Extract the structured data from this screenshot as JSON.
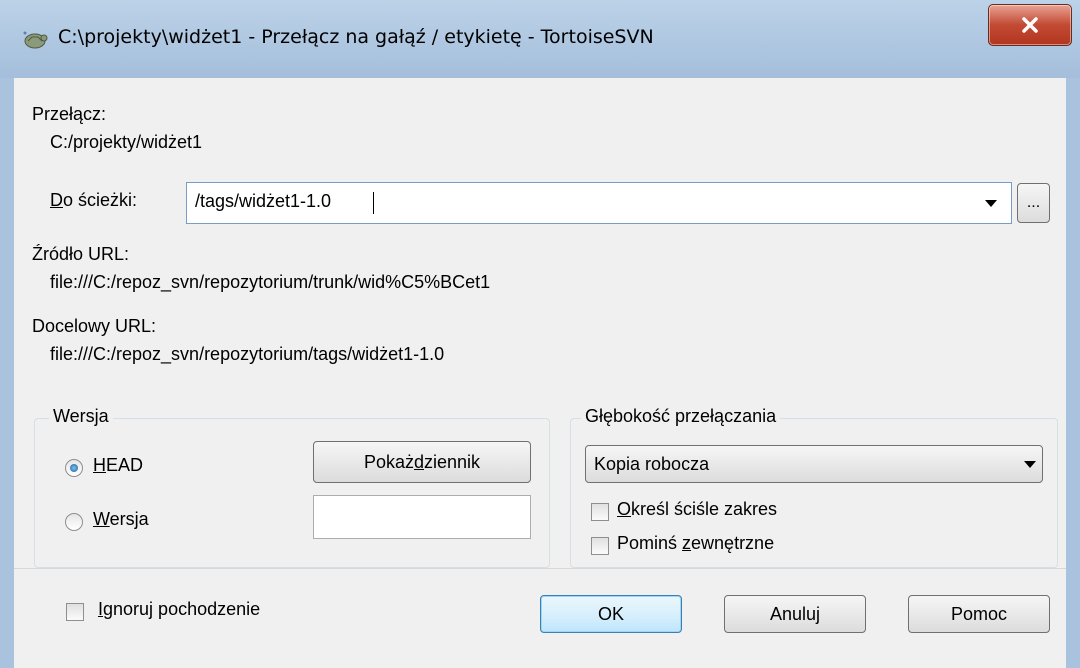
{
  "window": {
    "title": "C:\\projekty\\widżet1 - Przełącz na gałąź / etykietę - TortoiseSVN",
    "app_icon": "tortoisesvn-icon",
    "close_icon": "close-icon"
  },
  "switch": {
    "label": "Przełącz:",
    "path": "C:/projekty/widżet1"
  },
  "to_path": {
    "label_accel": "D",
    "label_rest": "o ścieżki:",
    "value": "/tags/widżet1-1.0",
    "browse_label": "..."
  },
  "source_url": {
    "label": "Źródło URL:",
    "value": "file:///C:/repoz_svn/repozytorium/trunk/wid%C5%BCet1"
  },
  "target_url": {
    "label": "Docelowy URL:",
    "value": "file:///C:/repoz_svn/repozytorium/tags/widżet1-1.0"
  },
  "revision": {
    "group_title": "Wersja",
    "head_accel": "H",
    "head_rest": "EAD",
    "head_selected": true,
    "rev_accel": "W",
    "rev_rest": "ersja",
    "rev_value": "",
    "log_button_pre": "Pokaż ",
    "log_button_accel": "d",
    "log_button_post": "ziennik"
  },
  "depth": {
    "group_title": "Głębokość przełączania",
    "selected": "Kopia robocza",
    "sticky_accel": "O",
    "sticky_rest": "kreśl ściśle zakres",
    "sticky_checked": false,
    "omit_pre": "Pominś ",
    "omit_accel": "z",
    "omit_post": "ewnętrzne",
    "omit_checked": false
  },
  "footer": {
    "ignore_accel": "I",
    "ignore_rest": "gnoruj pochodzenie",
    "ignore_checked": false,
    "ok_label": "OK",
    "cancel_label": "Anuluj",
    "help_label": "Pomoc"
  }
}
